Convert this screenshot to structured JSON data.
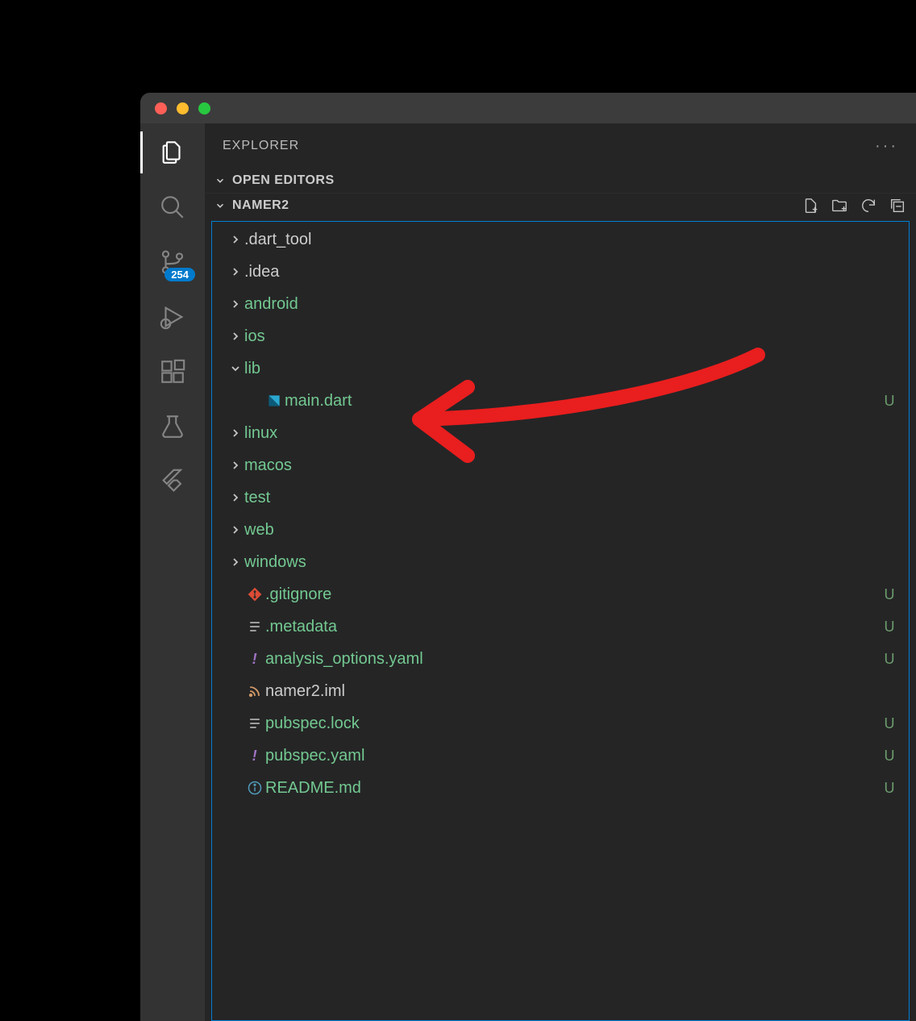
{
  "sidebar": {
    "title": "EXPLORER",
    "section_open_editors": "OPEN EDITORS",
    "project_name": "NAMER2"
  },
  "activitybar": {
    "source_control_badge": "254"
  },
  "tree": [
    {
      "type": "folder",
      "name": ".dart_tool",
      "expanded": false,
      "indent": 0,
      "status": "",
      "color": ""
    },
    {
      "type": "folder",
      "name": ".idea",
      "expanded": false,
      "indent": 0,
      "status": "",
      "color": ""
    },
    {
      "type": "folder",
      "name": "android",
      "expanded": false,
      "indent": 0,
      "status": "dot",
      "color": "untracked"
    },
    {
      "type": "folder",
      "name": "ios",
      "expanded": false,
      "indent": 0,
      "status": "dot",
      "color": "untracked"
    },
    {
      "type": "folder",
      "name": "lib",
      "expanded": true,
      "indent": 0,
      "status": "dot",
      "color": "untracked"
    },
    {
      "type": "file",
      "name": "main.dart",
      "icon": "dart",
      "indent": 1,
      "status": "U",
      "color": "untracked"
    },
    {
      "type": "folder",
      "name": "linux",
      "expanded": false,
      "indent": 0,
      "status": "dot",
      "color": "untracked"
    },
    {
      "type": "folder",
      "name": "macos",
      "expanded": false,
      "indent": 0,
      "status": "dot",
      "color": "untracked"
    },
    {
      "type": "folder",
      "name": "test",
      "expanded": false,
      "indent": 0,
      "status": "dot",
      "color": "untracked"
    },
    {
      "type": "folder",
      "name": "web",
      "expanded": false,
      "indent": 0,
      "status": "dot",
      "color": "untracked"
    },
    {
      "type": "folder",
      "name": "windows",
      "expanded": false,
      "indent": 0,
      "status": "dot",
      "color": "untracked"
    },
    {
      "type": "file",
      "name": ".gitignore",
      "icon": "git",
      "indent": 0,
      "status": "U",
      "color": "untracked"
    },
    {
      "type": "file",
      "name": ".metadata",
      "icon": "lines",
      "indent": 0,
      "status": "U",
      "color": "untracked"
    },
    {
      "type": "file",
      "name": "analysis_options.yaml",
      "icon": "yaml",
      "indent": 0,
      "status": "U",
      "color": "untracked"
    },
    {
      "type": "file",
      "name": "namer2.iml",
      "icon": "rss",
      "indent": 0,
      "status": "",
      "color": ""
    },
    {
      "type": "file",
      "name": "pubspec.lock",
      "icon": "lines",
      "indent": 0,
      "status": "U",
      "color": "untracked"
    },
    {
      "type": "file",
      "name": "pubspec.yaml",
      "icon": "yaml",
      "indent": 0,
      "status": "U",
      "color": "untracked"
    },
    {
      "type": "file",
      "name": "README.md",
      "icon": "info",
      "indent": 0,
      "status": "U",
      "color": "untracked"
    }
  ]
}
